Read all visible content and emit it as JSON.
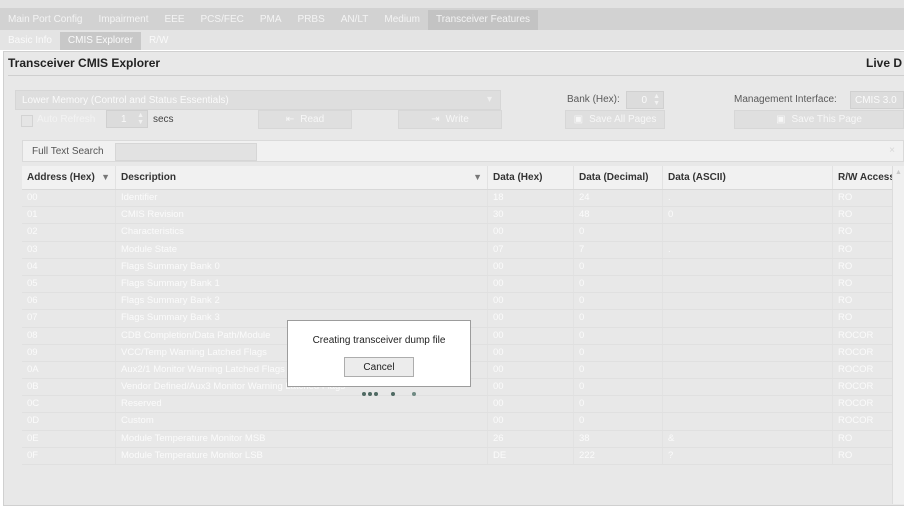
{
  "top_tabs": [
    "Main Port Config",
    "Impairment",
    "EEE",
    "PCS/FEC",
    "PMA",
    "PRBS",
    "AN/LT",
    "Medium",
    "Transceiver Features"
  ],
  "top_tabs_active": "Transceiver Features",
  "sub_tabs": [
    "Basic Info",
    "CMIS Explorer",
    "R/W"
  ],
  "sub_tabs_active": "CMIS Explorer",
  "panel": {
    "title": "Transceiver CMIS Explorer",
    "right_title": "Live D"
  },
  "controls": {
    "memory_select": "Lower Memory (Control and Status Essentials)",
    "bank_label": "Bank (Hex):",
    "bank_value": "0",
    "mgmt_label": "Management Interface:",
    "mgmt_value": "CMIS 3.0",
    "auto_refresh_label": "Auto Refresh",
    "refresh_value": "1",
    "secs_label": "secs",
    "read_label": "Read",
    "write_label": "Write",
    "save_all_label": "Save All Pages",
    "save_this_label": "Save This Page"
  },
  "search": {
    "label": "Full Text Search",
    "value": "",
    "clear": "×"
  },
  "table": {
    "columns": [
      "Address (Hex)",
      "Description",
      "Data (Hex)",
      "Data (Decimal)",
      "Data (ASCII)",
      "R/W Access"
    ],
    "rows": [
      [
        "00",
        "Identifier",
        "18",
        "24",
        ".",
        "RO"
      ],
      [
        "01",
        "CMIS Revision",
        "30",
        "48",
        "0",
        "RO"
      ],
      [
        "02",
        "Characteristics",
        "00",
        "0",
        "",
        "RO"
      ],
      [
        "03",
        "Module State",
        "07",
        "7",
        ".",
        "RO"
      ],
      [
        "04",
        "Flags Summary Bank 0",
        "00",
        "0",
        "",
        "RO"
      ],
      [
        "05",
        "Flags Summary Bank 1",
        "00",
        "0",
        "",
        "RO"
      ],
      [
        "06",
        "Flags Summary Bank 2",
        "00",
        "0",
        "",
        "RO"
      ],
      [
        "07",
        "Flags Summary Bank 3",
        "00",
        "0",
        "",
        "RO"
      ],
      [
        "08",
        "CDB Completion/Data Path/Module",
        "00",
        "0",
        "",
        "ROCOR"
      ],
      [
        "09",
        "VCC/Temp Warning Latched Flags",
        "00",
        "0",
        "",
        "ROCOR"
      ],
      [
        "0A",
        "Aux2/1 Monitor Warning Latched Flags",
        "00",
        "0",
        "",
        "ROCOR"
      ],
      [
        "0B",
        "Vendor Defined/Aux3 Monitor Warning Latched Flags",
        "00",
        "0",
        "",
        "ROCOR"
      ],
      [
        "0C",
        "Reserved",
        "00",
        "0",
        "",
        "ROCOR"
      ],
      [
        "0D",
        "Custom",
        "00",
        "0",
        "",
        "ROCOR"
      ],
      [
        "0E",
        "Module Temperature Monitor MSB",
        "26",
        "38",
        "&",
        "RO"
      ],
      [
        "0F",
        "Module Temperature Monitor LSB",
        "DE",
        "222",
        "?",
        "RO"
      ]
    ]
  },
  "dialog": {
    "message": "Creating transceiver dump file",
    "cancel_label": "Cancel"
  }
}
